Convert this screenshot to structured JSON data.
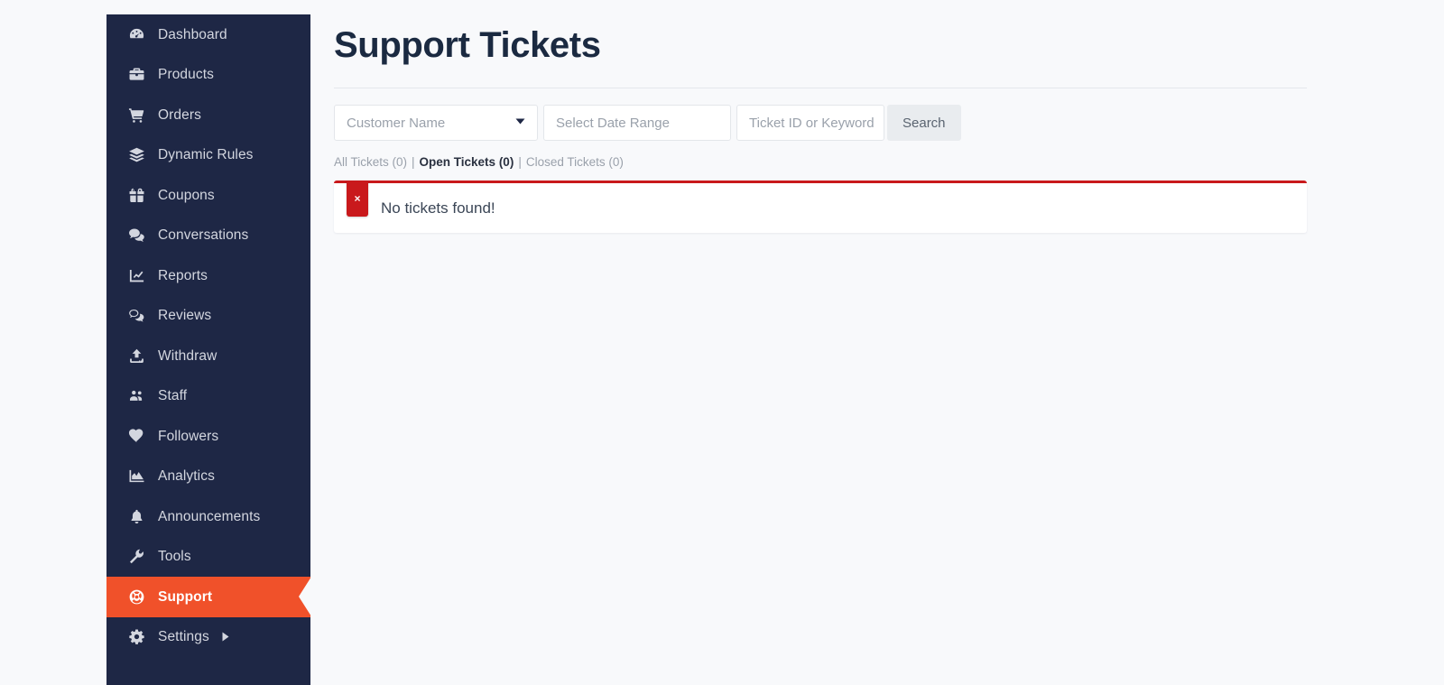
{
  "theme": {
    "sidebar_bg": "#1e2745",
    "sidebar_text": "#d3d6df",
    "active_bg": "#f0512a",
    "active_text": "#ffffff",
    "page_bg": "#f8f9fb",
    "title_color": "#1b2a41",
    "alert_accent": "#c9191c",
    "button_bg": "#e9ecef"
  },
  "sidebar": {
    "items": [
      {
        "label": "Dashboard",
        "icon": "gauge-icon",
        "active": false,
        "submenu": false
      },
      {
        "label": "Products",
        "icon": "briefcase-icon",
        "active": false,
        "submenu": false
      },
      {
        "label": "Orders",
        "icon": "shopping-cart-icon",
        "active": false,
        "submenu": false
      },
      {
        "label": "Dynamic Rules",
        "icon": "layers-icon",
        "active": false,
        "submenu": false
      },
      {
        "label": "Coupons",
        "icon": "gift-icon",
        "active": false,
        "submenu": false
      },
      {
        "label": "Conversations",
        "icon": "chat-bubbles-icon",
        "active": false,
        "submenu": false
      },
      {
        "label": "Reports",
        "icon": "line-chart-icon",
        "active": false,
        "submenu": false
      },
      {
        "label": "Reviews",
        "icon": "comments-o-icon",
        "active": false,
        "submenu": false
      },
      {
        "label": "Withdraw",
        "icon": "upload-icon",
        "active": false,
        "submenu": false
      },
      {
        "label": "Staff",
        "icon": "users-icon",
        "active": false,
        "submenu": false
      },
      {
        "label": "Followers",
        "icon": "heart-icon",
        "active": false,
        "submenu": false
      },
      {
        "label": "Analytics",
        "icon": "area-chart-icon",
        "active": false,
        "submenu": false
      },
      {
        "label": "Announcements",
        "icon": "bell-icon",
        "active": false,
        "submenu": false
      },
      {
        "label": "Tools",
        "icon": "wrench-icon",
        "active": false,
        "submenu": false
      },
      {
        "label": "Support",
        "icon": "lifebuoy-icon",
        "active": true,
        "submenu": false
      },
      {
        "label": "Settings",
        "icon": "gear-icon",
        "active": false,
        "submenu": true
      }
    ]
  },
  "main": {
    "page_title": "Support Tickets",
    "filters": {
      "customer_select": {
        "placeholder": "Customer Name",
        "value": "",
        "caret_icon": "chevron-down-icon"
      },
      "date_range": {
        "placeholder": "Select Date Range",
        "value": ""
      },
      "keyword": {
        "placeholder": "Ticket ID or Keyword",
        "value": ""
      },
      "search_button": "Search"
    },
    "tabs": [
      {
        "label": "All Tickets (0)",
        "count": 0,
        "active": false
      },
      {
        "label": "Open Tickets (0)",
        "count": 0,
        "active": true
      },
      {
        "label": "Closed Tickets (0)",
        "count": 0,
        "active": false
      }
    ],
    "tab_separator": "|",
    "alert": {
      "message": "No tickets found!",
      "close_label": "×",
      "close_icon": "close-icon",
      "type": "danger"
    }
  }
}
